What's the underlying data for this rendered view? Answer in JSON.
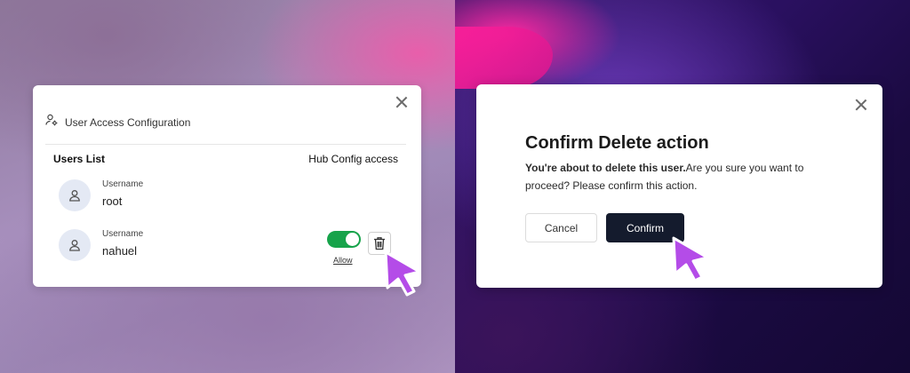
{
  "left_panel": {
    "title": "User Access Configuration",
    "users_list_header": "Users List",
    "hub_access_header": "Hub Config access",
    "users": [
      {
        "label": "Username",
        "name": "root"
      },
      {
        "label": "Username",
        "name": "nahuel",
        "hub_access_enabled": true,
        "toggle_caption": "Allow"
      }
    ],
    "icons": [
      "user-settings-icon",
      "user-icon",
      "trash-icon",
      "close-icon",
      "cursor-icon"
    ],
    "colors": {
      "toggle_on": "#16a34a",
      "avatar_bg": "#e4e9f4"
    }
  },
  "right_panel": {
    "title": "Confirm Delete action",
    "message_bold": "You're about to delete this user.",
    "message_rest": "Are you sure you want to proceed? Please confirm this action.",
    "cancel_label": "Cancel",
    "confirm_label": "Confirm",
    "icons": [
      "close-icon",
      "cursor-icon"
    ],
    "colors": {
      "confirm_bg": "#141b2d",
      "cursor": "#b44ce8"
    }
  }
}
